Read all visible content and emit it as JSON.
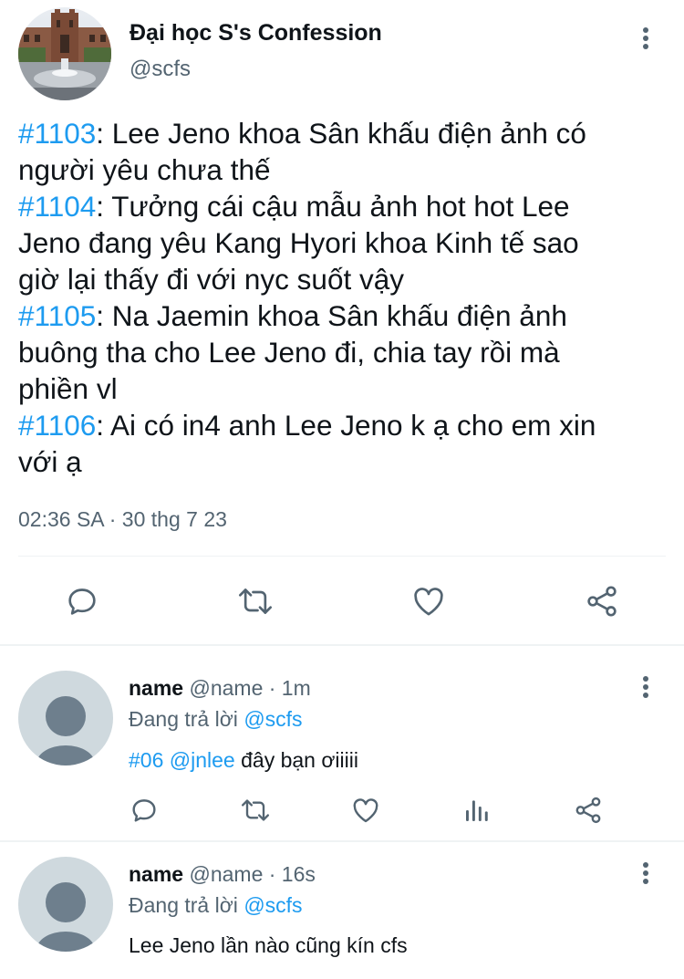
{
  "tweet": {
    "display_name": "Đại học S's Confession",
    "handle": "@scfs",
    "lines": [
      {
        "tag": "#1103",
        "text": ": Lee Jeno khoa Sân khấu điện ảnh có"
      },
      {
        "tag": "",
        "text": "người yêu chưa thế"
      },
      {
        "tag": "#1104",
        "text": ": Tưởng cái cậu mẫu ảnh hot hot Lee"
      },
      {
        "tag": "",
        "text": "Jeno đang yêu Kang Hyori khoa Kinh tế sao"
      },
      {
        "tag": "",
        "text": "giờ lại thấy đi với nyc suốt vậy"
      },
      {
        "tag": "#1105",
        "text": ": Na Jaemin khoa Sân khấu điện ảnh"
      },
      {
        "tag": "",
        "text": "buông tha cho Lee Jeno đi, chia tay rồi mà"
      },
      {
        "tag": "",
        "text": "phiền vl"
      },
      {
        "tag": "#1106",
        "text": ": Ai có in4 anh Lee Jeno k ạ cho em xin"
      },
      {
        "tag": "",
        "text": "với ạ"
      }
    ],
    "timestamp": "02:36 SA · 30 thg 7 23"
  },
  "replies": [
    {
      "name": "name",
      "meta": "@name · 1m",
      "replying_prefix": "Đang trả lời ",
      "replying_handle": "@scfs",
      "text_tag": "#06",
      "text_mention": "@jnlee",
      "text_rest": " đây bạn ơiiiii"
    },
    {
      "name": "name",
      "meta": "@name · 16s",
      "replying_prefix": "Đang trả lời ",
      "replying_handle": "@scfs",
      "text_tag": "",
      "text_mention": "",
      "text_rest": "Lee Jeno lần nào cũng kín cfs"
    }
  ],
  "colors": {
    "accent": "#1d9bf0",
    "secondary_text": "#536471",
    "primary_text": "#0f1419",
    "divider": "#eff3f4",
    "avatar_placeholder": "#cfd9de"
  },
  "icons": [
    "reply-icon",
    "retweet-icon",
    "like-icon",
    "share-icon",
    "views-icon",
    "more-icon"
  ]
}
